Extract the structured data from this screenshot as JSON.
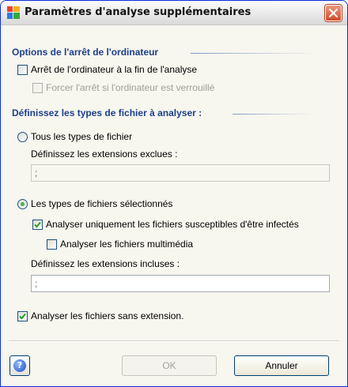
{
  "window": {
    "title": "Paramètres d'analyse supplémentaires"
  },
  "shutdown_section": {
    "title": "Options de l'arrêt de l'ordinateur",
    "shutdown_after_scan": {
      "label": "Arrêt de l'ordinateur à la fin de l'analyse",
      "checked": false
    },
    "force_shutdown": {
      "label": "Forcer l'arrêt si l'ordinateur est verrouillé",
      "checked": false,
      "enabled": false
    }
  },
  "filetypes_section": {
    "title": "Définissez les types de fichier à analyser :",
    "all_types": {
      "label": "Tous les types de fichier",
      "selected": false
    },
    "excluded_ext_label": "Définissez les extensions exclues :",
    "excluded_ext_value": ";",
    "selected_types": {
      "label": "Les types de fichiers sélectionnés",
      "selected": true
    },
    "only_infectable": {
      "label": "Analyser uniquement les fichiers susceptibles d'être infectés",
      "checked": true
    },
    "multimedia": {
      "label": "Analyser les fichiers multimédia",
      "checked": false
    },
    "included_ext_label": "Définissez les extensions incluses :",
    "included_ext_value": ";",
    "no_extension": {
      "label": "Analyser les fichiers sans extension.",
      "checked": true
    }
  },
  "buttons": {
    "help": "?",
    "ok": "OK",
    "cancel": "Annuler"
  }
}
